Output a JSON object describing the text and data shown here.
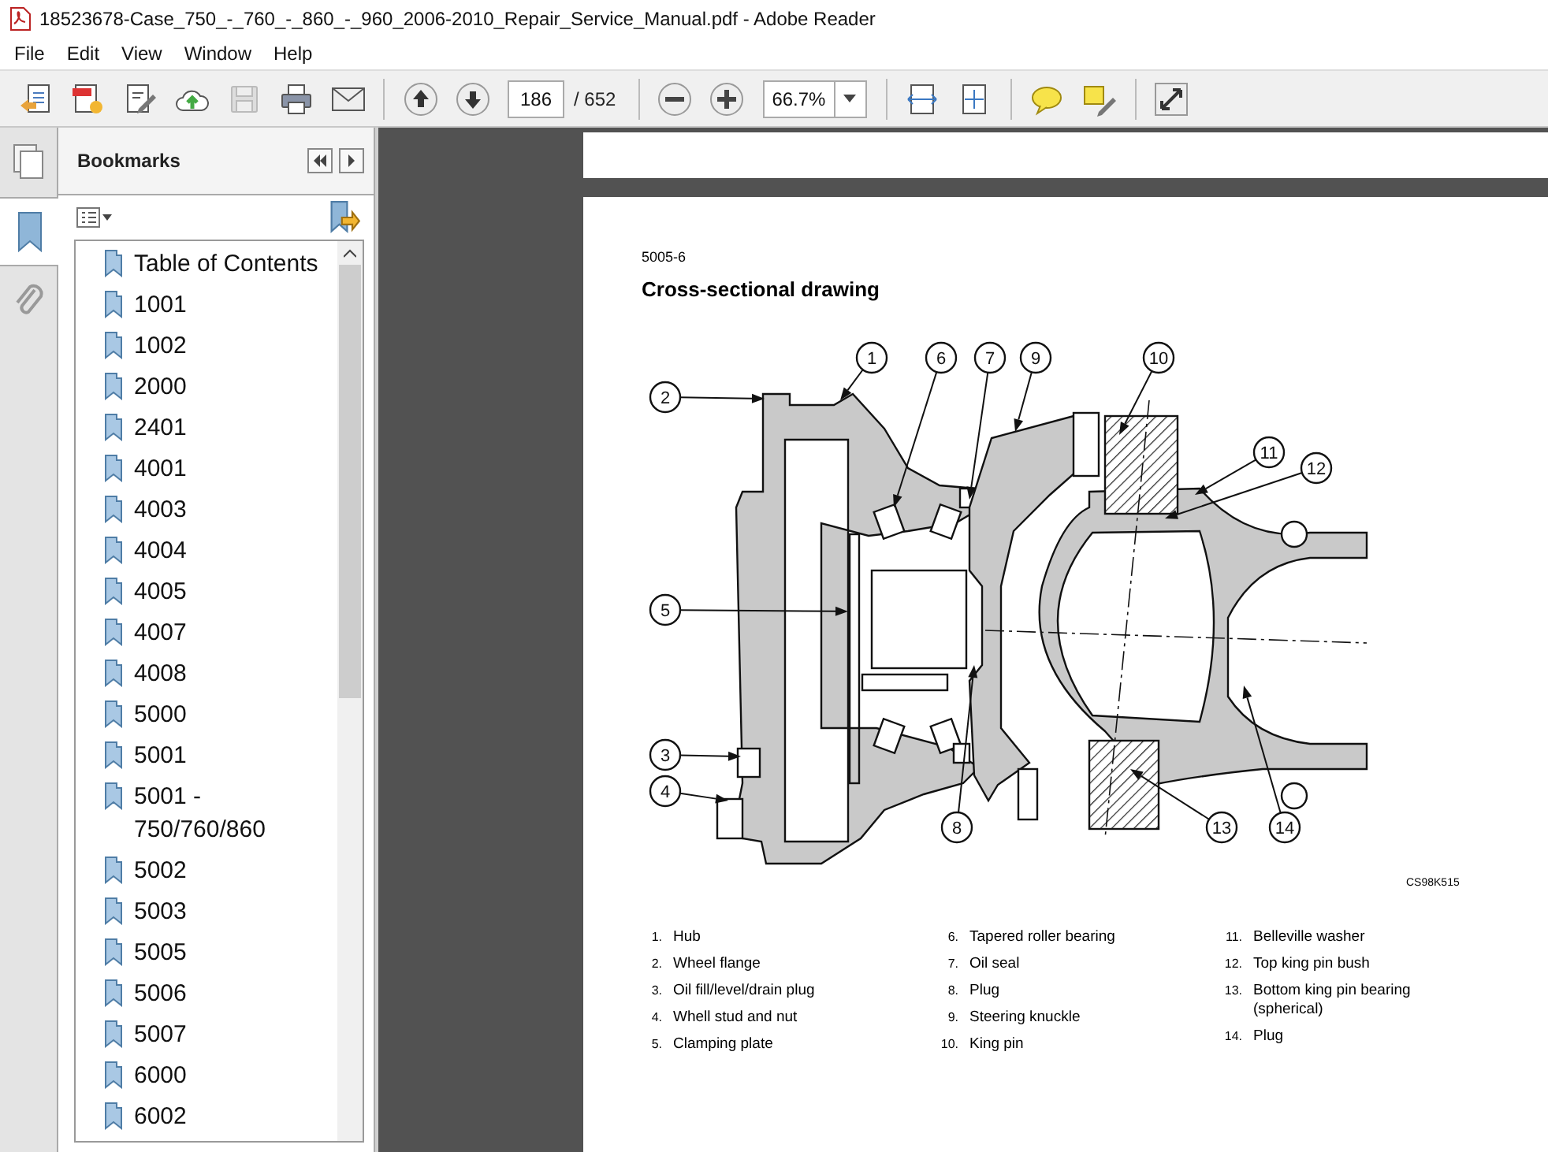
{
  "window": {
    "title": "18523678-Case_750_-_760_-_860_-_960_2006-2010_Repair_Service_Manual.pdf - Adobe Reader"
  },
  "menu": [
    "File",
    "Edit",
    "View",
    "Window",
    "Help"
  ],
  "toolbar": {
    "tools": [
      {
        "kind": "open",
        "disabled": false
      },
      {
        "kind": "create",
        "disabled": false
      },
      {
        "kind": "sign",
        "disabled": false
      },
      {
        "kind": "upload",
        "disabled": false
      },
      {
        "kind": "save",
        "disabled": true
      },
      {
        "kind": "print",
        "disabled": false
      },
      {
        "kind": "email",
        "disabled": false
      }
    ],
    "page_number": "186",
    "page_count": "/ 652",
    "zoom": "66.7%"
  },
  "nav_panels": [
    {
      "kind": "pages",
      "selected": false
    },
    {
      "kind": "bookmarks",
      "selected": true
    },
    {
      "kind": "attachments",
      "selected": false
    }
  ],
  "bookmarks": {
    "title": "Bookmarks",
    "items": [
      "Table of Contents",
      "1001",
      "1002",
      "2000",
      "2401",
      "4001",
      "4003",
      "4004",
      "4005",
      "4007",
      "4008",
      "5000",
      "5001",
      "5001 - 750/760/860",
      "5002",
      "5003",
      "5005",
      "5006",
      "5007",
      "6000",
      "6002"
    ]
  },
  "document": {
    "section": "5005-6",
    "heading": "Cross-sectional drawing",
    "callouts": [
      "1",
      "6",
      "7",
      "9",
      "10",
      "11",
      "12",
      "2",
      "5",
      "3",
      "4",
      "8",
      "13",
      "14"
    ],
    "figure_code": "CS98K515",
    "legend": [
      {
        "number": "1.",
        "text": "Hub"
      },
      {
        "number": "2.",
        "text": "Wheel flange"
      },
      {
        "number": "3.",
        "text": "Oil fill/level/drain plug"
      },
      {
        "number": "4.",
        "text": "Whell stud and nut"
      },
      {
        "number": "5.",
        "text": "Clamping plate"
      },
      {
        "number": "6.",
        "text": "Tapered roller bearing"
      },
      {
        "number": "7.",
        "text": "Oil seal"
      },
      {
        "number": "8.",
        "text": "Plug"
      },
      {
        "number": "9.",
        "text": "Steering knuckle"
      },
      {
        "number": "10.",
        "text": "King pin"
      },
      {
        "number": "11.",
        "text": "Belleville washer"
      },
      {
        "number": "12.",
        "text": "Top king pin bush"
      },
      {
        "number": "13.",
        "text": "Bottom king pin bearing (spherical)"
      },
      {
        "number": "14.",
        "text": "Plug"
      }
    ]
  }
}
